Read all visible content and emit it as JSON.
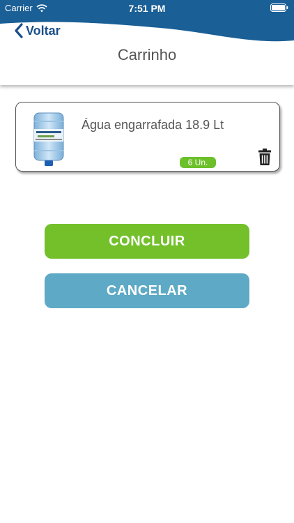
{
  "status_bar": {
    "carrier": "Carrier",
    "time": "7:51 PM",
    "wifi_icon": "wifi-icon",
    "battery_icon": "battery-icon"
  },
  "header": {
    "back_label": "Voltar",
    "back_icon": "chevron-left-icon",
    "title": "Carrinho",
    "wave_color": "#1a5f96"
  },
  "cart": {
    "items": [
      {
        "name": "Água engarrafada 18.9 Lt",
        "quantity": "6 Un.",
        "image_icon": "water-bottle-image",
        "delete_icon": "trash-icon"
      }
    ]
  },
  "actions": {
    "confirm_label": "CONCLUIR",
    "cancel_label": "CANCELAR",
    "confirm_color": "#73c02b",
    "cancel_color": "#5ea9c5"
  }
}
